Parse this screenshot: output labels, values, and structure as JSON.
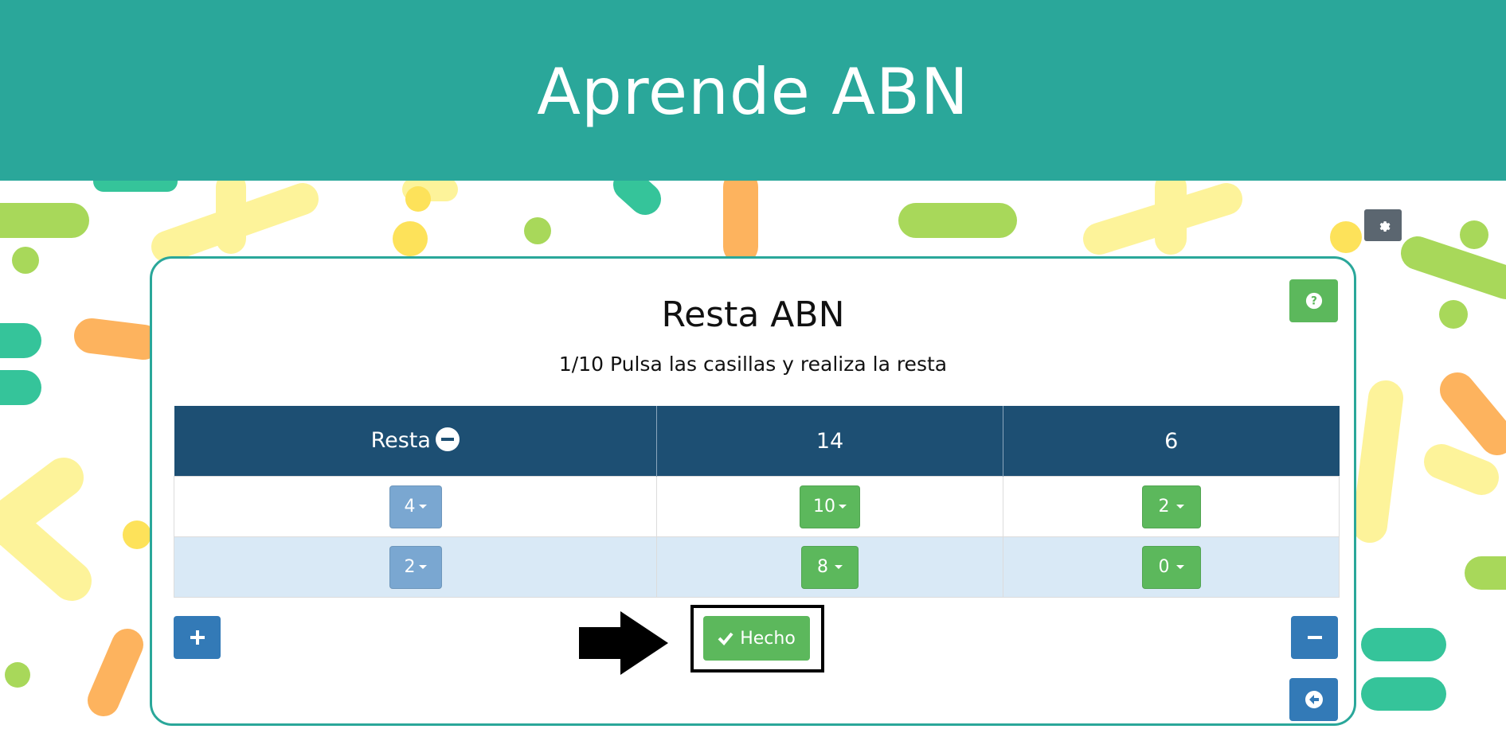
{
  "app": {
    "title": "Aprende ABN"
  },
  "exercise": {
    "title": "Resta ABN",
    "instruction": "1/10 Pulsa las casillas y realiza la resta"
  },
  "table": {
    "headers": [
      "Resta",
      "14",
      "6"
    ],
    "rows": [
      [
        "4",
        "10",
        "2"
      ],
      [
        "2",
        "8",
        "0"
      ]
    ]
  },
  "actions": {
    "done_label": "Hecho"
  },
  "colors": {
    "header_bg": "#2aa79a",
    "table_header": "#1d4f73",
    "primary": "#337ab7",
    "success": "#5cb85c",
    "row_alt": "#d9e9f6"
  },
  "icons": {
    "settings": "gear-icon",
    "help": "question-circle-icon",
    "operation": "minus-circle-icon",
    "add_row": "plus-icon",
    "remove_row": "minus-icon",
    "back": "arrow-circle-left-icon",
    "done": "check-icon",
    "pointer": "arrow-right-icon"
  }
}
